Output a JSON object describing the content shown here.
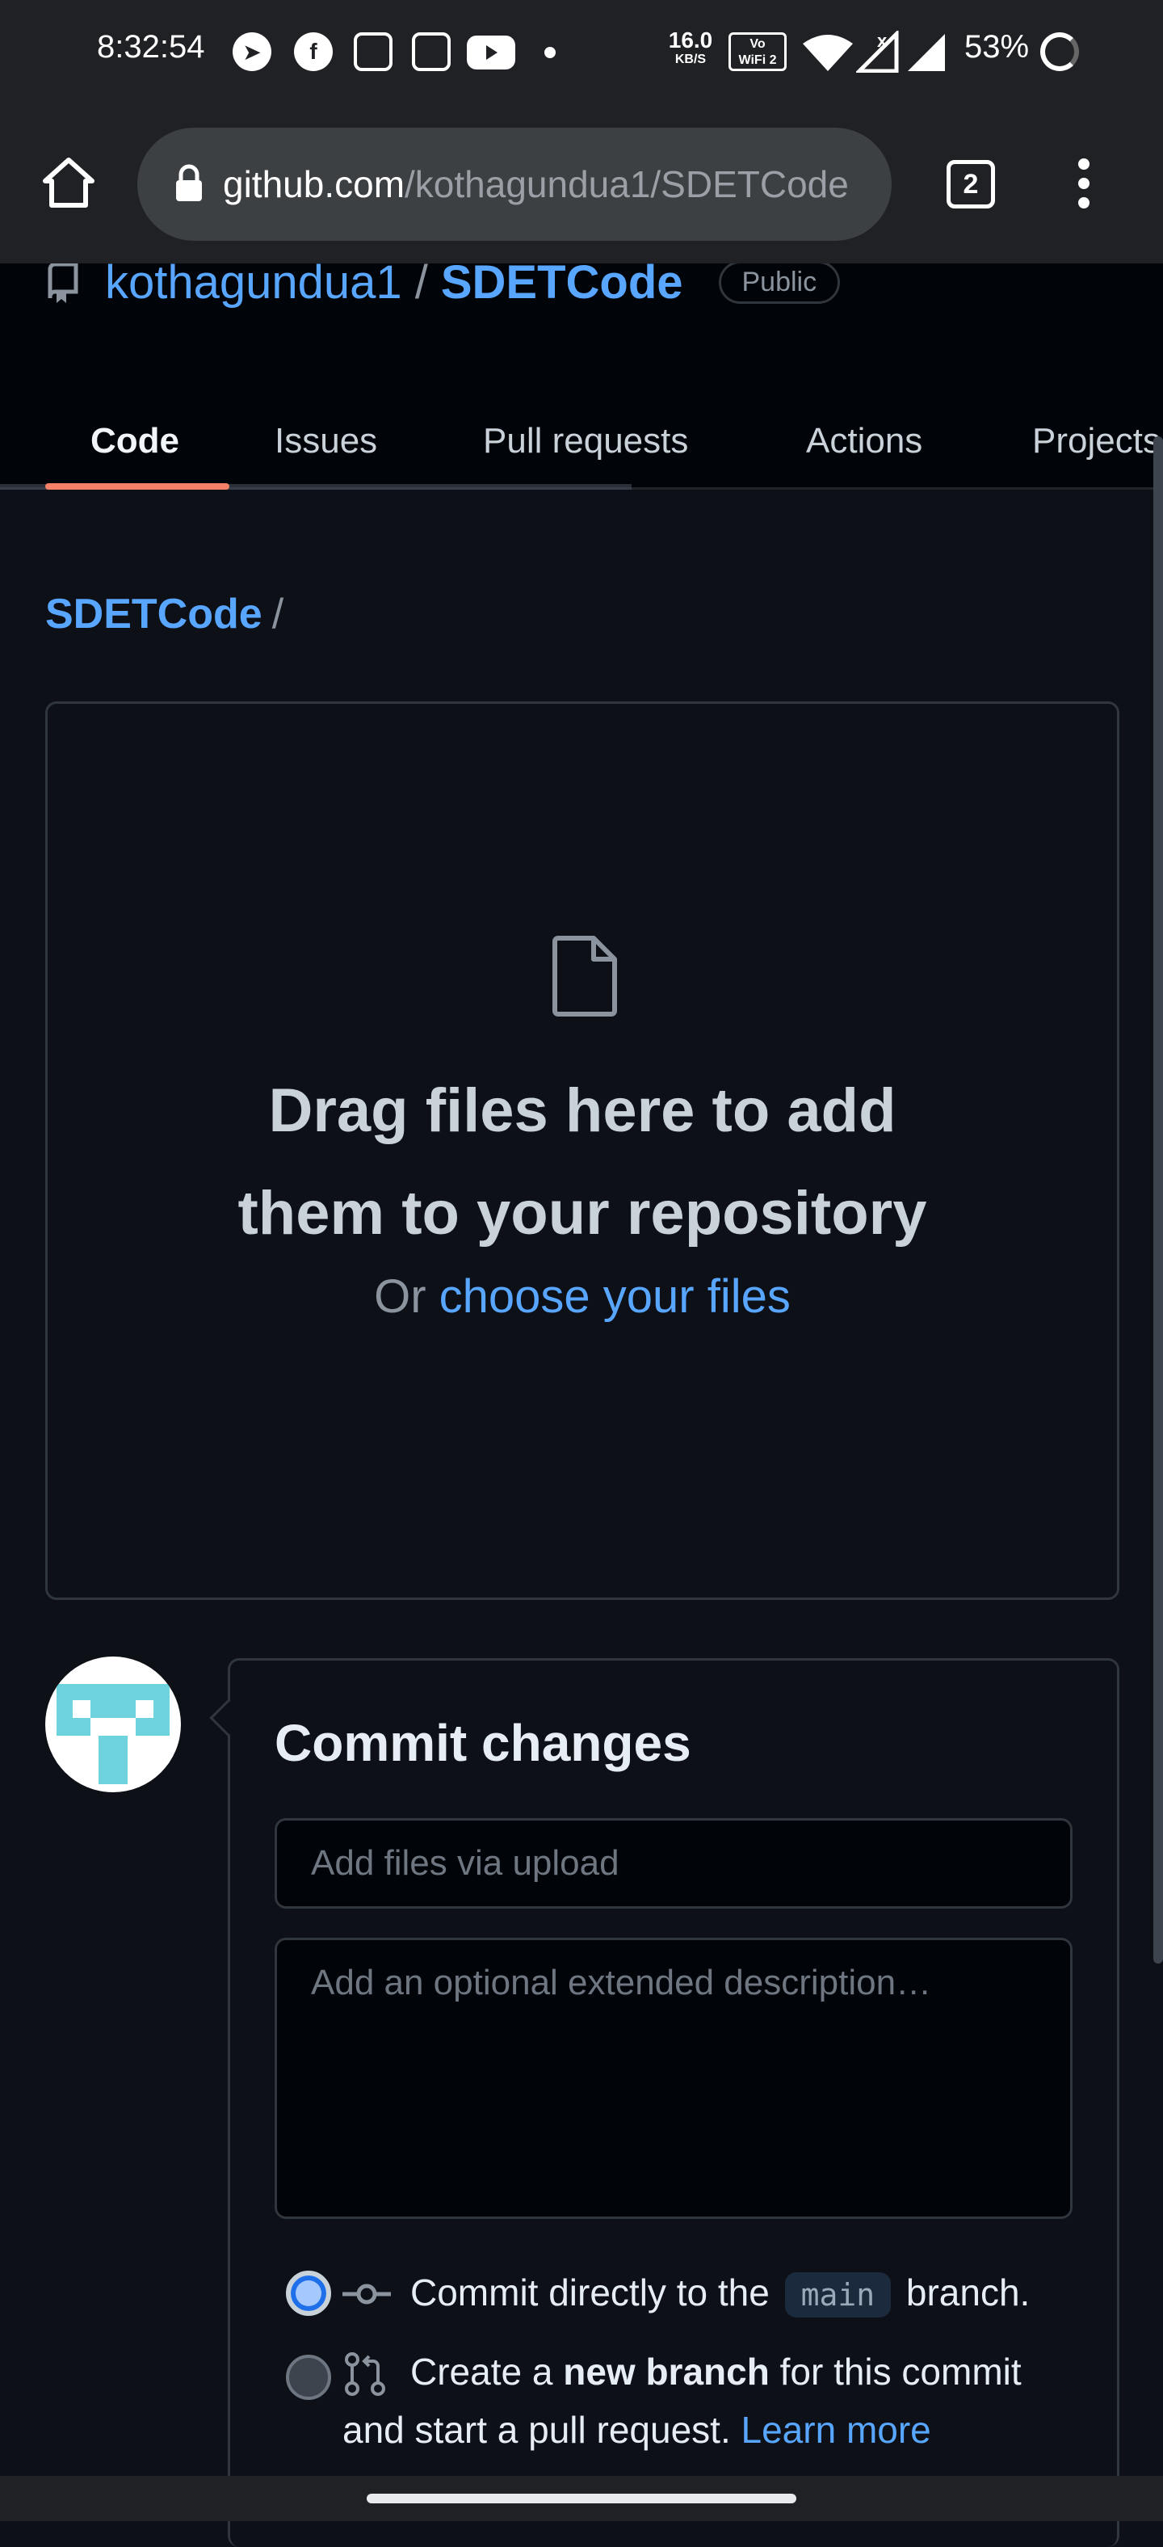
{
  "status_bar": {
    "time": "8:32:54",
    "net_speed_value": "16.0",
    "net_speed_unit": "KB/S",
    "volte_label_1": "Vo",
    "volte_label_2": "WiFi 2",
    "battery": "53%"
  },
  "browser": {
    "url_host": "github.com",
    "url_path": "/kothagundua1/SDETCode",
    "tabs_count": "2"
  },
  "repo": {
    "owner": "kothagundua1",
    "separator": "/",
    "name": "SDETCode",
    "visibility": "Public"
  },
  "tabs": [
    {
      "label": "Code",
      "active": true
    },
    {
      "label": "Issues"
    },
    {
      "label": "Pull requests"
    },
    {
      "label": "Actions"
    },
    {
      "label": "Projects"
    }
  ],
  "breadcrumb": {
    "repo": "SDETCode",
    "separator": "/"
  },
  "upload": {
    "title": "Drag files here to add them to your repository",
    "subtitle_prefix": "Or",
    "subtitle_link": "choose your files"
  },
  "commit": {
    "title": "Commit changes",
    "summary_placeholder": "Add files via upload",
    "description_placeholder": "Add an optional extended description…",
    "option_direct_prefix": "Commit directly to the",
    "option_direct_branch": "main",
    "option_direct_suffix": "branch.",
    "option_new_prefix": "Create a",
    "option_new_bold": "new branch",
    "option_new_suffix": "for this commit",
    "option_new_line2": "and start a pull request.",
    "option_new_link": "Learn more",
    "selected": "direct"
  },
  "colors": {
    "link": "#58a6ff",
    "background": "#0d1117",
    "active_tab_underline": "#f78166",
    "avatar_teal": "#6fd3dd"
  },
  "icons": [
    "telegram-icon",
    "facebook-icon",
    "calculator-icon",
    "youtube-icon",
    "wifi-icon",
    "signal-icon",
    "lock-icon",
    "home-icon",
    "repo-icon",
    "file-icon",
    "git-commit-icon",
    "git-pull-request-icon"
  ]
}
